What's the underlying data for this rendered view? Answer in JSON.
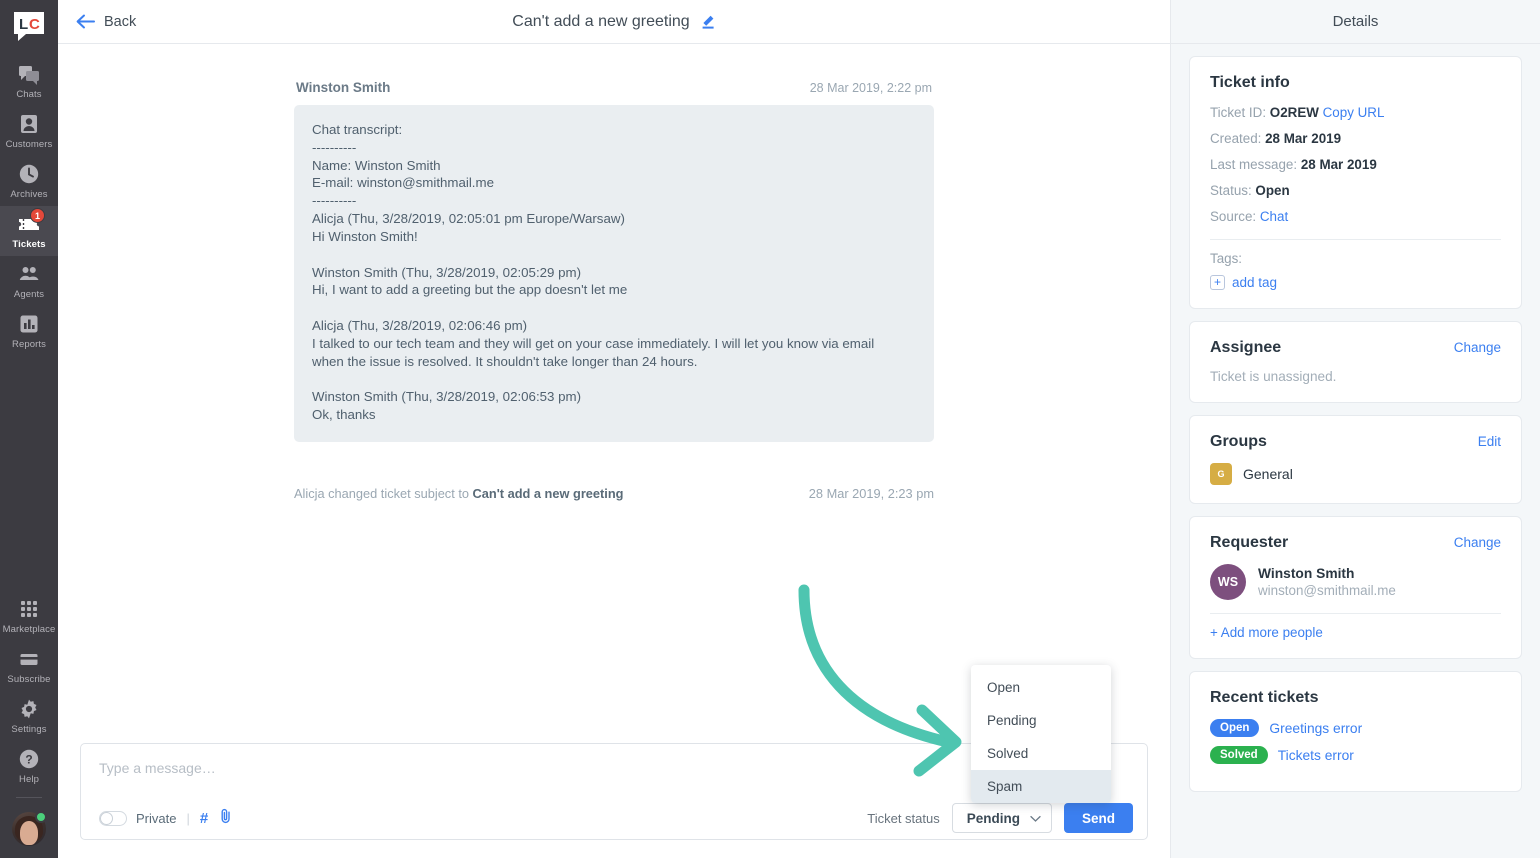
{
  "colors": {
    "accent_blue": "#3b7ff0",
    "nav_bg": "#3c3b41",
    "badge_red": "#e4483a",
    "arrow_green": "#4ec5b0",
    "solved_green": "#2bb14f",
    "group_gold": "#d6ad44",
    "avatar_purple": "#7d4f7e"
  },
  "sidebar": {
    "logo_text": "LC",
    "items": [
      {
        "label": "Chats",
        "icon": "chats-icon",
        "active": false,
        "badge": null
      },
      {
        "label": "Customers",
        "icon": "customers-icon",
        "active": false,
        "badge": null
      },
      {
        "label": "Archives",
        "icon": "archives-icon",
        "active": false,
        "badge": null
      },
      {
        "label": "Tickets",
        "icon": "tickets-icon",
        "active": true,
        "badge": "1"
      },
      {
        "label": "Agents",
        "icon": "agents-icon",
        "active": false,
        "badge": null
      },
      {
        "label": "Reports",
        "icon": "reports-icon",
        "active": false,
        "badge": null
      }
    ],
    "bottom_items": [
      {
        "label": "Marketplace",
        "icon": "marketplace-icon"
      },
      {
        "label": "Subscribe",
        "icon": "subscribe-icon"
      },
      {
        "label": "Settings",
        "icon": "gear-icon"
      },
      {
        "label": "Help",
        "icon": "help-icon"
      }
    ],
    "agent_status": "online"
  },
  "topbar": {
    "back_label": "Back",
    "title": "Can't add a new greeting",
    "edit_icon": "pencil-icon"
  },
  "conversation": {
    "message": {
      "author": "Winston Smith",
      "timestamp": "28 Mar 2019, 2:22 pm",
      "body": "Chat transcript:\n----------\nName: Winston Smith\nE-mail: winston@smithmail.me\n----------\nAlicja (Thu, 3/28/2019, 02:05:01 pm Europe/Warsaw)\nHi Winston Smith!\n\nWinston Smith (Thu, 3/28/2019, 02:05:29 pm)\nHi, I want to add a greeting but the app doesn't let me\n\nAlicja (Thu, 3/28/2019, 02:06:46 pm)\nI talked to our tech team and they will get on your case immediately. I will let you know via email\nwhen the issue is resolved. It shouldn't take longer than 24 hours.\n\nWinston Smith (Thu, 3/28/2019, 02:06:53 pm)\nOk, thanks"
    },
    "system_event": {
      "prefix": "Alicja changed ticket subject to ",
      "subject": "Can't add a new greeting",
      "timestamp": "28 Mar 2019, 2:23 pm"
    }
  },
  "composer": {
    "placeholder": "Type a message…",
    "value": "",
    "private_label": "Private",
    "private_on": false,
    "hashtag_icon": "#",
    "attach_icon": "paperclip-icon",
    "ticket_status_label": "Ticket status",
    "status_value": "Pending",
    "chevron_icon": "chevron-down-icon",
    "send_label": "Send"
  },
  "status_dropdown": {
    "open": true,
    "options": [
      "Open",
      "Pending",
      "Solved",
      "Spam"
    ],
    "highlighted": "Spam"
  },
  "annotation": {
    "type": "curved-arrow",
    "points_to": "status-dropdown"
  },
  "details": {
    "header": "Details",
    "ticket_info": {
      "title": "Ticket info",
      "rows": [
        {
          "label": "Ticket ID:",
          "value": "O2REW",
          "link": "Copy URL"
        },
        {
          "label": "Created:",
          "value": "28 Mar 2019"
        },
        {
          "label": "Last message:",
          "value": "28 Mar 2019"
        },
        {
          "label": "Status:",
          "value": "Open"
        },
        {
          "label": "Source:",
          "value": "Chat",
          "value_is_link": true
        }
      ],
      "tags_label": "Tags:",
      "add_tag_label": "add tag",
      "add_tag_icon": "plus-icon"
    },
    "assignee": {
      "title": "Assignee",
      "action": "Change",
      "empty_text": "Ticket is unassigned."
    },
    "groups": {
      "title": "Groups",
      "action": "Edit",
      "items": [
        {
          "initial": "G",
          "name": "General"
        }
      ]
    },
    "requester": {
      "title": "Requester",
      "action": "Change",
      "initials": "WS",
      "name": "Winston Smith",
      "email": "winston@smithmail.me",
      "add_more_label": "+ Add more people"
    },
    "recent_tickets": {
      "title": "Recent tickets",
      "items": [
        {
          "status": "Open",
          "status_class": "open",
          "title": "Greetings error"
        },
        {
          "status": "Solved",
          "status_class": "solved",
          "title": "Tickets error"
        }
      ]
    }
  }
}
